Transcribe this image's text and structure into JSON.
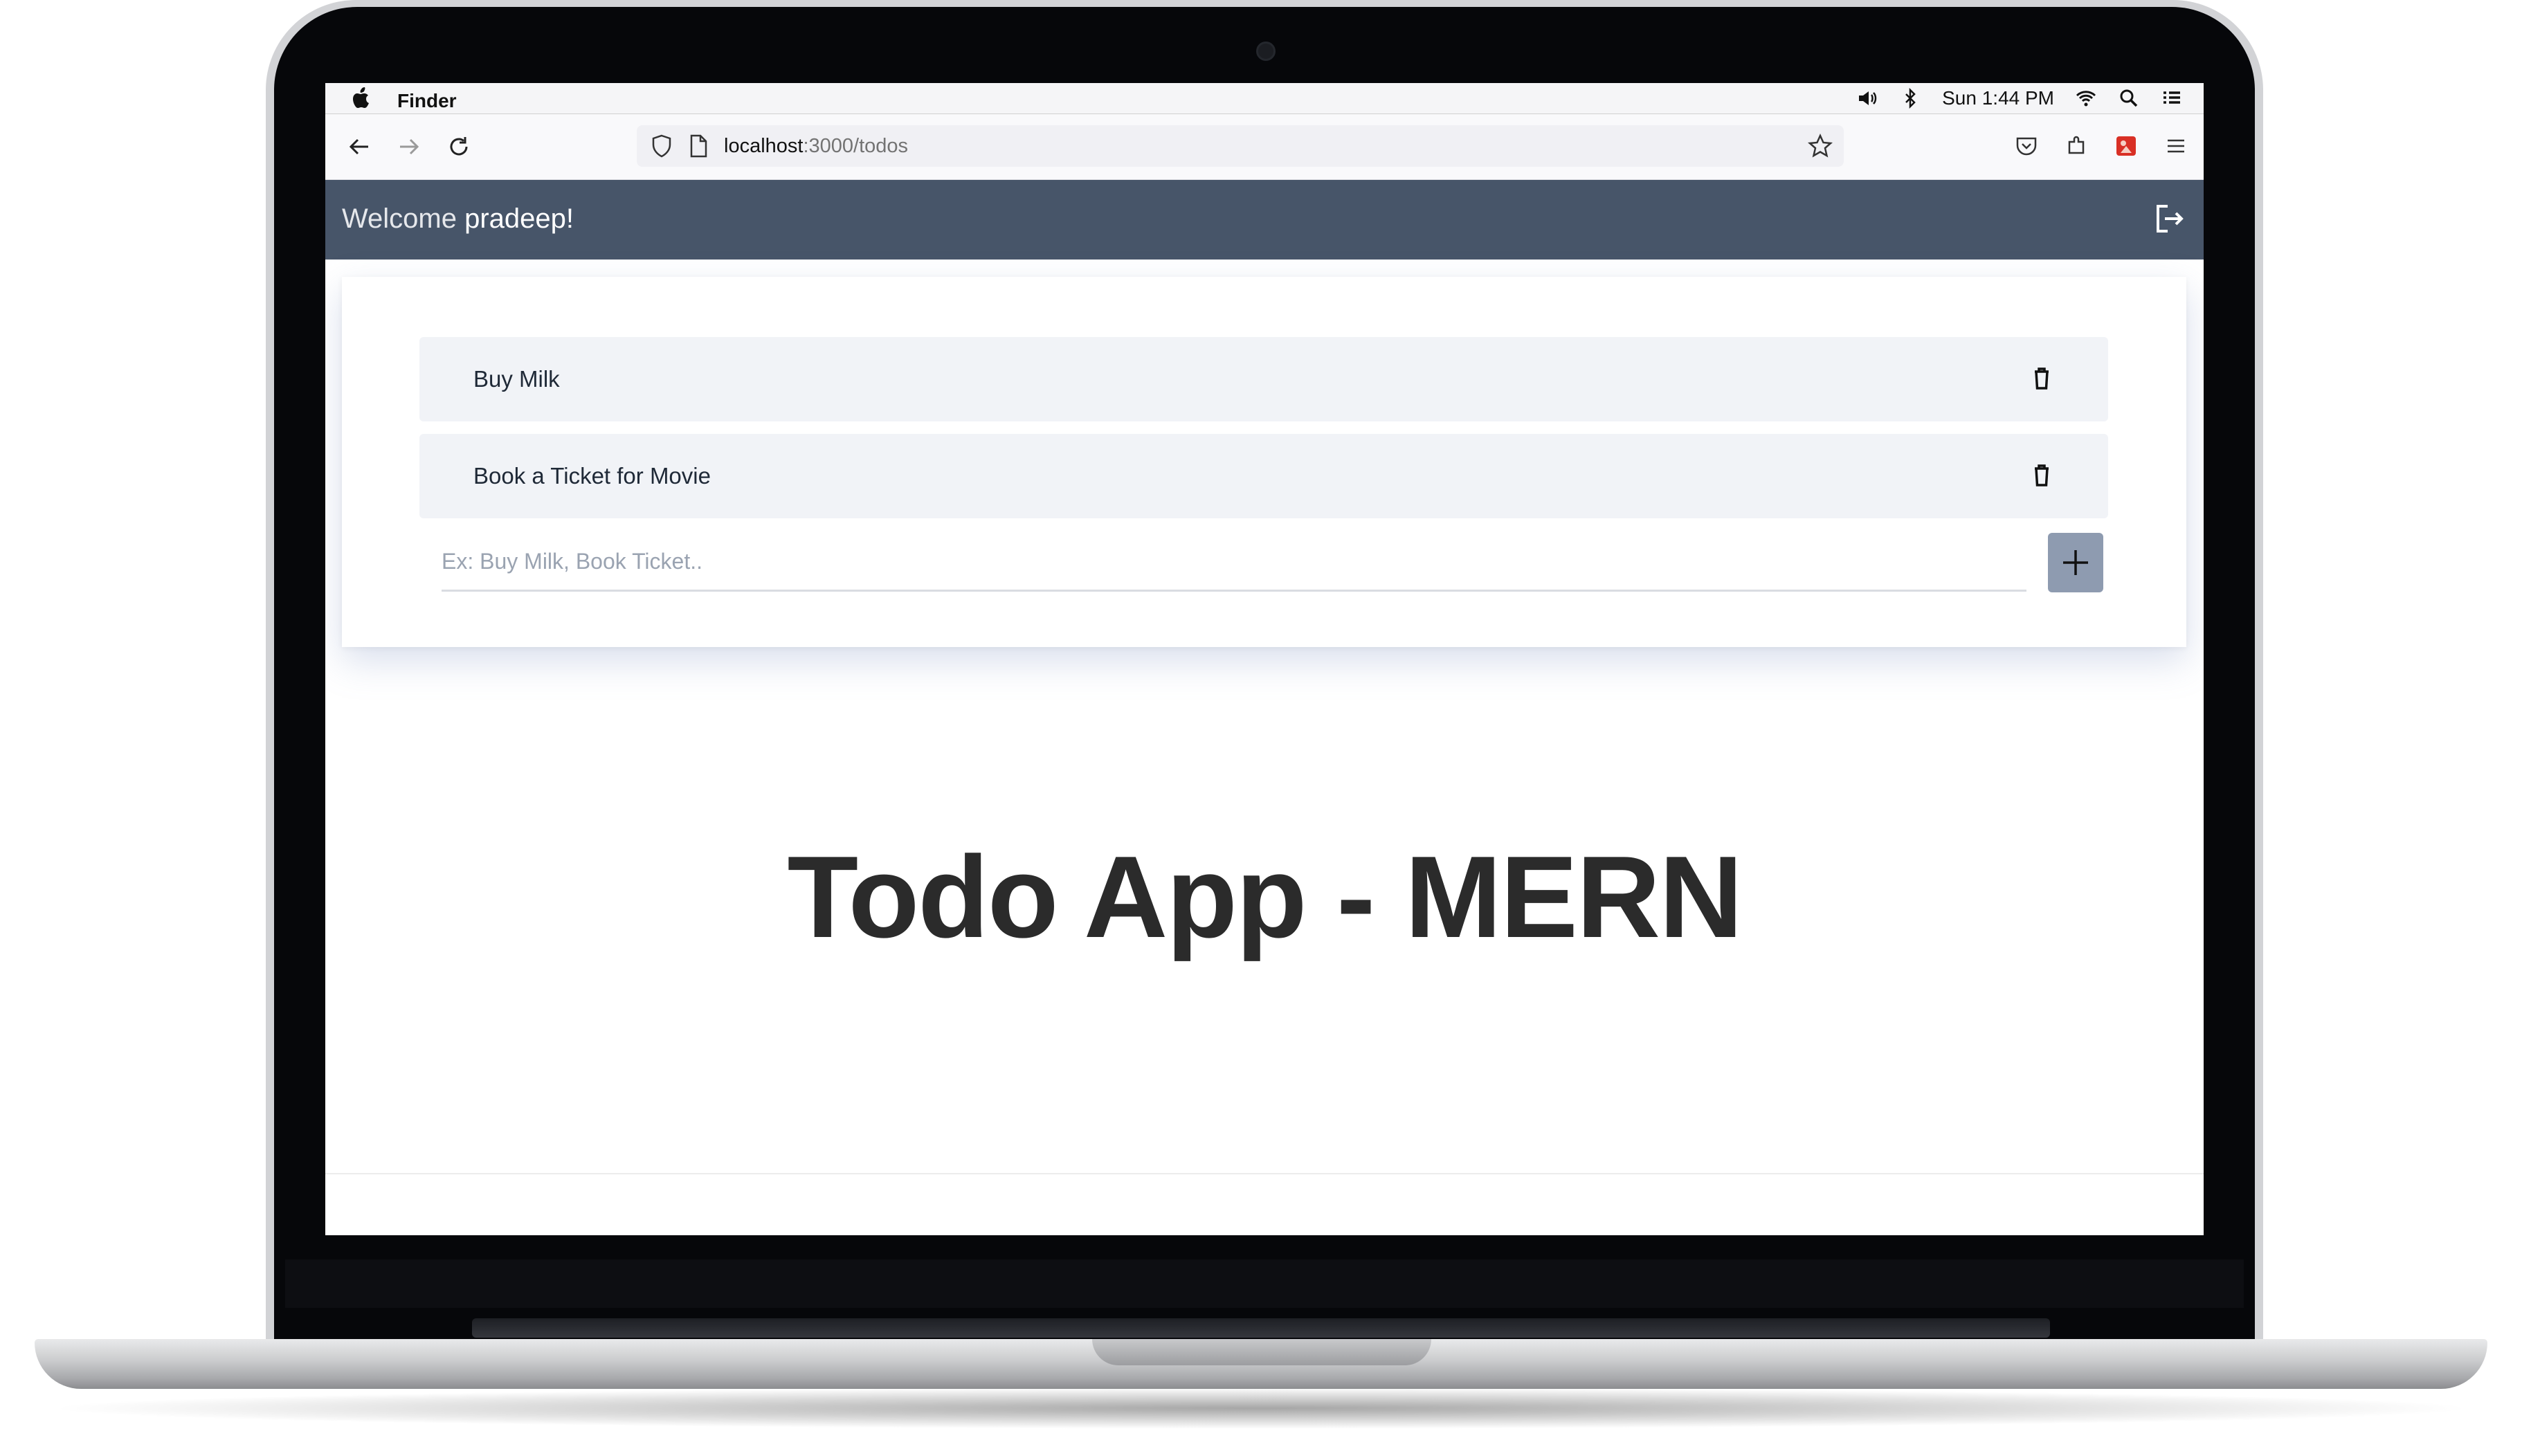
{
  "menubar": {
    "app_name": "Finder",
    "clock": "Sun 1:44 PM",
    "icons": [
      "apple-icon",
      "volume-icon",
      "bluetooth-icon",
      "wifi-icon",
      "spotlight-icon",
      "control-center-icon"
    ]
  },
  "browser": {
    "url_host": "localhost",
    "url_path": ":3000/todos",
    "icons": [
      "back-arrow-icon",
      "forward-arrow-icon",
      "reload-icon",
      "shield-icon",
      "page-icon",
      "star-icon",
      "pocket-icon",
      "extensions-icon",
      "addon-icon",
      "hamburger-menu-icon"
    ]
  },
  "app": {
    "welcome_prefix": "Welcome",
    "username": "pradeep!",
    "todos": [
      {
        "text": "Buy Milk"
      },
      {
        "text": "Book a Ticket for Movie"
      }
    ],
    "input_placeholder": "Ex: Buy Milk, Book Ticket..",
    "title": "Todo App - MERN",
    "colors": {
      "header": "#475569",
      "item_background": "#f1f3f7",
      "add_button": "#8e9bb0"
    }
  }
}
